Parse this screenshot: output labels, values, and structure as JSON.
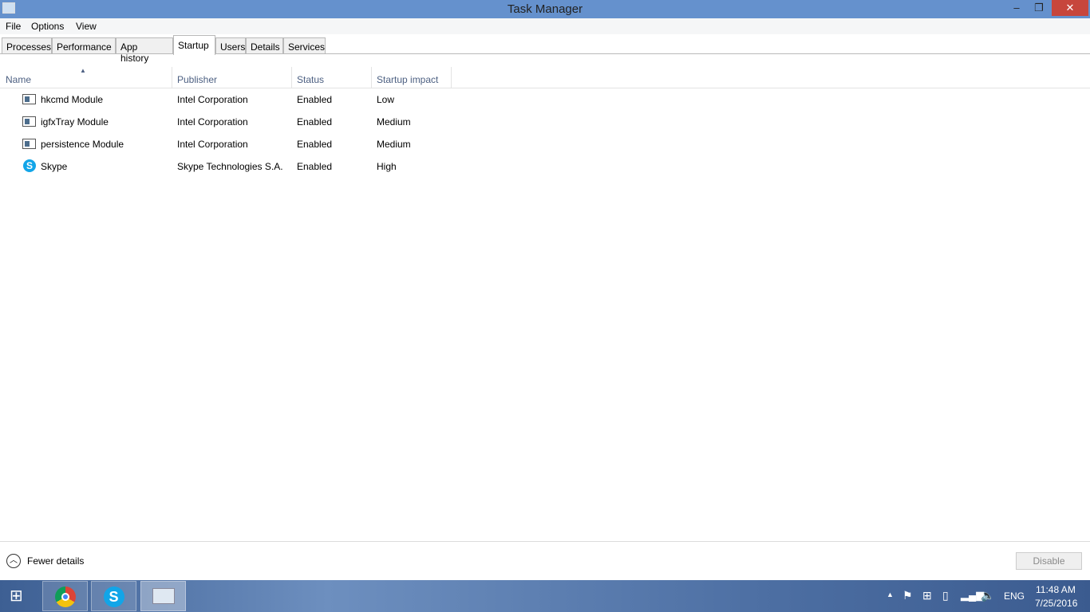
{
  "window": {
    "title": "Task Manager"
  },
  "menu": [
    "File",
    "Options",
    "View"
  ],
  "tabs": [
    "Processes",
    "Performance",
    "App history",
    "Startup",
    "Users",
    "Details",
    "Services"
  ],
  "columns": [
    "Name",
    "Publisher",
    "Status",
    "Startup impact"
  ],
  "rows": [
    {
      "name": "hkcmd Module",
      "publisher": "Intel Corporation",
      "status": "Enabled",
      "impact": "Low",
      "icon": "module-icon"
    },
    {
      "name": "igfxTray Module",
      "publisher": "Intel Corporation",
      "status": "Enabled",
      "impact": "Medium",
      "icon": "module-icon"
    },
    {
      "name": "persistence Module",
      "publisher": "Intel Corporation",
      "status": "Enabled",
      "impact": "Medium",
      "icon": "module-icon"
    },
    {
      "name": "Skype",
      "publisher": "Skype Technologies S.A.",
      "status": "Enabled",
      "impact": "High",
      "icon": "skype-icon"
    }
  ],
  "footer": {
    "fewer": "Fewer details",
    "disable": "Disable"
  },
  "tray": {
    "lang": "ENG",
    "time": "11:48 AM",
    "date": "7/25/2016"
  }
}
